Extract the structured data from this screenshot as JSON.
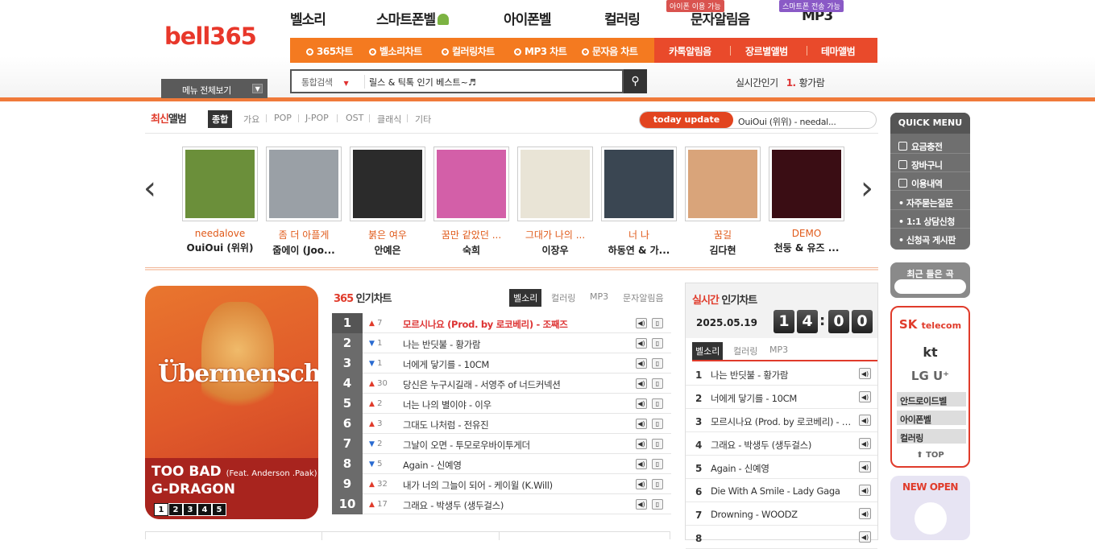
{
  "logo": "bell365",
  "main_nav": [
    {
      "label": "벨소리",
      "badge": ""
    },
    {
      "label": "스마트폰벨",
      "badge": ""
    },
    {
      "label": "아이폰벨",
      "badge": ""
    },
    {
      "label": "컬러링",
      "badge": ""
    },
    {
      "label": "문자알림음",
      "badge": "아이폰 이용 가능"
    },
    {
      "label": "MP3",
      "badge": "스마트폰 전송 가능"
    }
  ],
  "sub_nav": [
    "365차트",
    "벨소리차트",
    "컬러링차트",
    "MP3 차트",
    "문자음 차트",
    "카톡알림음",
    "장르별앨범",
    "테마앨범"
  ],
  "menu_all": "메뉴 전체보기",
  "search": {
    "category": "통합검색",
    "value": "릴스 & 틱톡 인기 베스트~♬"
  },
  "realtime": {
    "label": "실시간인기",
    "rank": "1.",
    "keyword": "황가람"
  },
  "latest_album": {
    "title_a": "최신",
    "title_b": "앨범",
    "tabs": [
      "종합",
      "가요",
      "POP",
      "J-POP",
      "OST",
      "클래식",
      "기타"
    ],
    "today_label": "today update",
    "today_text": "OuiOui (위위) - needal...",
    "albums": [
      {
        "title": "needalove",
        "artist": "OuiOui (위위)",
        "color": "#6b8f3a"
      },
      {
        "title": "좀 더 아플게",
        "artist": "줍에이 (Joo...",
        "color": "#9aa0a6"
      },
      {
        "title": "붉은 여우",
        "artist": "안예은",
        "color": "#2b2b2b"
      },
      {
        "title": "꿈만 같았던 ...",
        "artist": "숙희",
        "color": "#d35fa8"
      },
      {
        "title": "그대가 나의 ...",
        "artist": "이장우",
        "color": "#e9e4d6"
      },
      {
        "title": "너 나",
        "artist": "하동연 & 가...",
        "color": "#3a4652"
      },
      {
        "title": "꿈길",
        "artist": "김다현",
        "color": "#d9a47a"
      },
      {
        "title": "DEMO",
        "artist": "천둥 & 유즈 ...",
        "color": "#3a0d14"
      }
    ]
  },
  "featured": {
    "cover_text": "Übermensch",
    "song": "TOO BAD",
    "feat": "(Feat. Anderson .Paak)",
    "artist": "G-DRAGON",
    "pages": [
      "1",
      "2",
      "3",
      "4",
      "5"
    ]
  },
  "chart365": {
    "title_a": "365",
    "title_b": " 인기차트",
    "tabs": [
      "벨소리",
      "컬러링",
      "MP3",
      "문자알림음"
    ],
    "rows": [
      {
        "rank": "1",
        "dir": "up",
        "change": "7",
        "title": "모르시나요 (Prod. by 로코베리) - 조째즈"
      },
      {
        "rank": "2",
        "dir": "down",
        "change": "1",
        "title": "나는 반딧불 - 황가람"
      },
      {
        "rank": "3",
        "dir": "down",
        "change": "1",
        "title": "너에게 닿기를 - 10CM"
      },
      {
        "rank": "4",
        "dir": "up",
        "change": "30",
        "title": "당신은 누구시길래 - 서영주 of 너드커넥션"
      },
      {
        "rank": "5",
        "dir": "up",
        "change": "2",
        "title": "너는 나의 별이야 - 이우"
      },
      {
        "rank": "6",
        "dir": "up",
        "change": "3",
        "title": "그대도 나처럼 - 전유진"
      },
      {
        "rank": "7",
        "dir": "down",
        "change": "2",
        "title": "그날이 오면 - 투모로우바이투게더"
      },
      {
        "rank": "8",
        "dir": "down",
        "change": "5",
        "title": "Again - 신예영"
      },
      {
        "rank": "9",
        "dir": "up",
        "change": "32",
        "title": "내가 너의 그늘이 되어 - 케이윌 (K.Will)"
      },
      {
        "rank": "10",
        "dir": "up",
        "change": "17",
        "title": "그래요 - 박생두 (생두걸스)"
      }
    ]
  },
  "realtime_chart": {
    "title_a": "실시간",
    "title_b": " 인기차트",
    "date": "2025.05.19",
    "digits": [
      "1",
      "4",
      "0",
      "0"
    ],
    "tabs": [
      "벨소리",
      "컬러링",
      "MP3"
    ],
    "rows": [
      {
        "rank": "1",
        "title": "나는 반딧불 - 황가람"
      },
      {
        "rank": "2",
        "title": "너에게 닿기를 - 10CM"
      },
      {
        "rank": "3",
        "title": "모르시나요 (Prod. by 로코베리) - 조째즈"
      },
      {
        "rank": "4",
        "title": "그래요 - 박생두 (생두걸스)"
      },
      {
        "rank": "5",
        "title": "Again - 신예영"
      },
      {
        "rank": "6",
        "title": "Die With A Smile - Lady Gaga"
      },
      {
        "rank": "7",
        "title": "Drowning - WOODZ"
      },
      {
        "rank": "8",
        "title": ""
      }
    ]
  },
  "quick_menu": {
    "title": "QUICK MENU",
    "items": [
      "요금충전",
      "장바구니",
      "이용내역",
      "• 자주묻는질문",
      "• 1:1 상담신청",
      "• 신청곡 게시판"
    ]
  },
  "recent": "최근 들은 곡",
  "telco": {
    "sk_a": "SK",
    "sk_b": "telecom",
    "kt": "kt",
    "lg": "LG U⁺",
    "menu": [
      "안드로이드벨",
      "아이폰벨",
      "컬러링"
    ],
    "top": "TOP"
  },
  "new_open": "NEW OPEN",
  "colors": {
    "accent": "#f47a20",
    "red": "#e03b2b"
  }
}
